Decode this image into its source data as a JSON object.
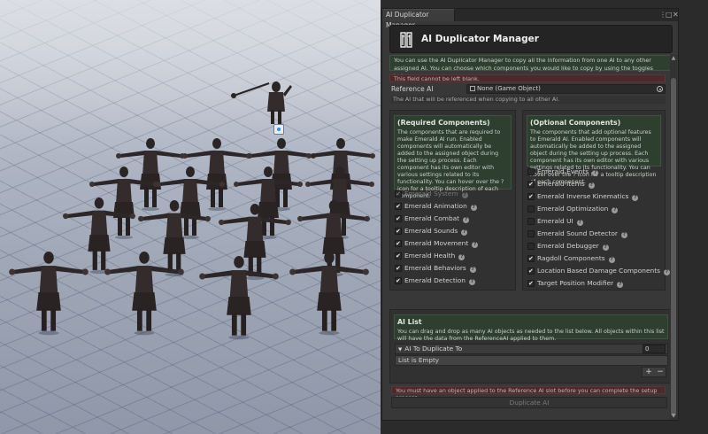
{
  "window": {
    "tab_label": "AI Duplicator Manager",
    "header_title": "AI Duplicator Manager"
  },
  "intro_text": "You can use the AI Duplicator Manager to copy all the information from one AI to any other assigned AI. You can choose which components you would like to copy by using the toggles below.",
  "blank_warning": "This field cannot be left blank.",
  "reference": {
    "label": "Reference AI",
    "value": "None (Game Object)",
    "help": "The AI that will be referenced when copying to all other AI."
  },
  "required": {
    "title": "(Required Components)",
    "description": "The components that are required to make Emerald AI run. Enabled components will automatically be added to the assigned object during the setting up process. Each component has its own editor with various settings related to its functionality. You can hover over the ? icon for a tooltip description of each component.",
    "items": [
      {
        "label": "Emerald System",
        "checked": true,
        "disabled": true
      },
      {
        "label": "Emerald Animation",
        "checked": true,
        "disabled": false
      },
      {
        "label": "Emerald Combat",
        "checked": true,
        "disabled": false
      },
      {
        "label": "Emerald Sounds",
        "checked": true,
        "disabled": false
      },
      {
        "label": "Emerald Movement",
        "checked": true,
        "disabled": false
      },
      {
        "label": "Emerald Health",
        "checked": true,
        "disabled": false
      },
      {
        "label": "Emerald Behaviors",
        "checked": true,
        "disabled": false
      },
      {
        "label": "Emerald Detection",
        "checked": true,
        "disabled": false
      }
    ]
  },
  "optional": {
    "title": "(Optional Components)",
    "description": "The components that add optional features to Emerald AI. Enabled components will automatically be added to the assigned object during the setting up process. Each component has its own editor with various settings related to its functionality. You can hover over the ? icon for a tooltip description of each component.",
    "items": [
      {
        "label": "Emerald Events",
        "checked": false
      },
      {
        "label": "Emerald Items",
        "checked": true
      },
      {
        "label": "Emerald Inverse Kinematics",
        "checked": true
      },
      {
        "label": "Emerald Optimization",
        "checked": false
      },
      {
        "label": "Emerald UI",
        "checked": false
      },
      {
        "label": "Emerald Sound Detector",
        "checked": false
      },
      {
        "label": "Emerald Debugger",
        "checked": false
      },
      {
        "label": "Ragdoll Components",
        "checked": true
      },
      {
        "label": "Location Based Damage Components",
        "checked": true
      },
      {
        "label": "Target Position Modifier",
        "checked": true
      }
    ]
  },
  "ai_list": {
    "title": "AI List",
    "description": "You can drag and drop as many AI objects as needed to the list below. All objects within this list will have the data from the ReferenceAI applied to them.",
    "list_title": "AI To Duplicate To",
    "count": "0",
    "empty_text": "List is Empty",
    "add_label": "+",
    "remove_label": "−"
  },
  "setup_warning": "You must have an object applied to the Reference AI slot before you can complete the setup process.",
  "duplicate_button": "Duplicate AI",
  "icons": {
    "menu": "⋮",
    "maximize": "□",
    "close": "✕",
    "help": "?",
    "scroll_up": "▲",
    "scroll_down": "▼",
    "foldout": "▼"
  },
  "colors": {
    "panel_green": "#2e3e2f",
    "warning_red": "#4a2a2a",
    "editor_bg": "#383838"
  }
}
